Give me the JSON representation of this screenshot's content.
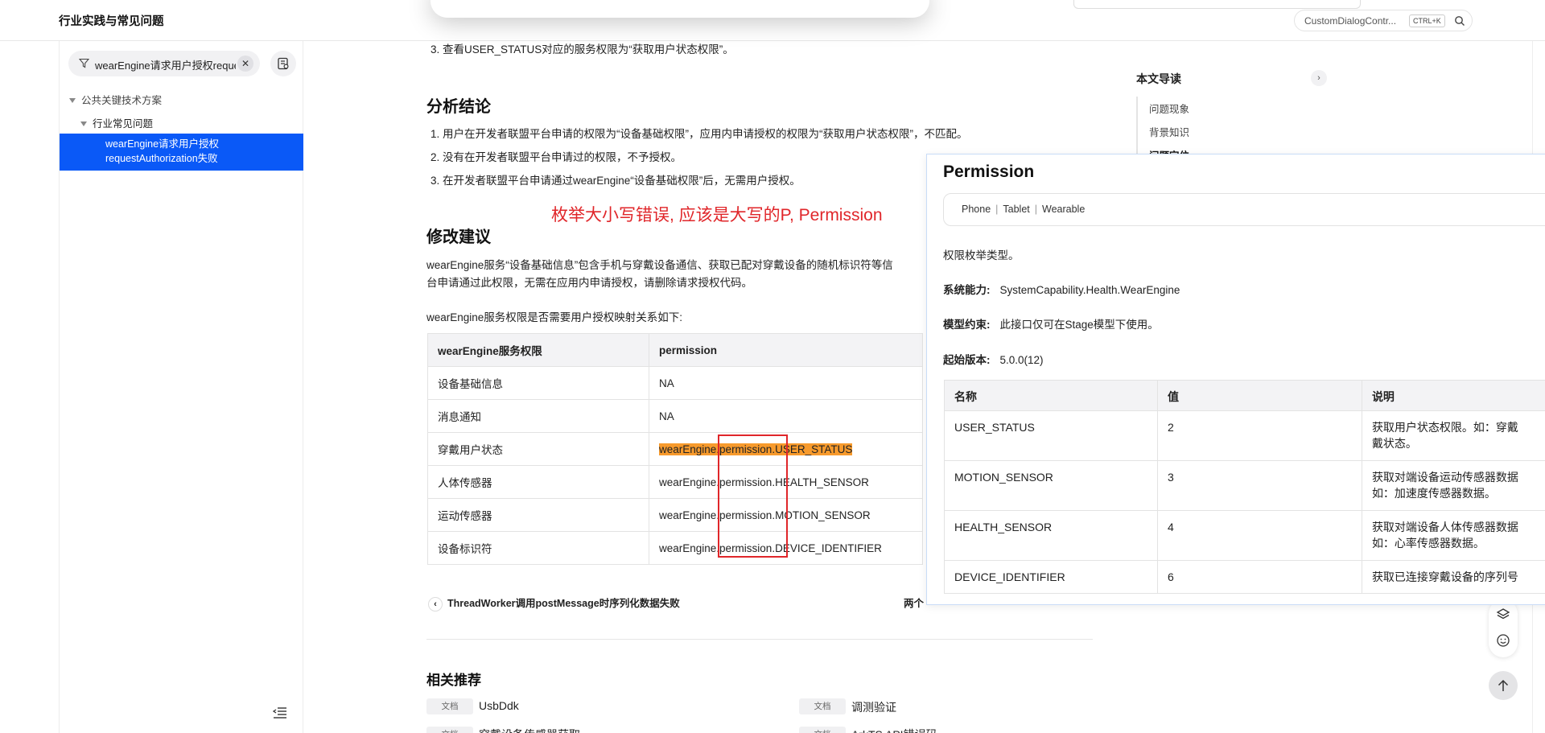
{
  "header": {
    "title": "行业实践与常见问题",
    "search_text": "CustomDialogContr...",
    "search_kbd": "CTRL+K"
  },
  "sidebar": {
    "filter_text": "wearEngine请求用户授权requestAuthorization失败",
    "items": [
      {
        "label": "公共关键技术方案"
      },
      {
        "label": "行业常见问题"
      }
    ],
    "active_line1": "wearEngine请求用户授权",
    "active_line2": "requestAuthorization失败"
  },
  "doc": {
    "step3": "3. 查看USER_STATUS对应的服务权限为“获取用户状态权限”。",
    "h_conclusion": "分析结论",
    "c1": "1. 用户在开发者联盟平台申请的权限为“设备基础权限”，应用内申请授权的权限为“获取用户状态权限”，不匹配。",
    "c2": "2. 没有在开发者联盟平台申请过的权限，不予授权。",
    "c3": "3. 在开发者联盟平台申请通过wearEngine“设备基础权限”后，无需用户授权。",
    "red_note": "枚举大小写错误, 应该是大写的P, Permission",
    "h_suggest": "修改建议",
    "s1": "wearEngine服务“设备基础信息”包含手机与穿戴设备通信、获取已配对穿戴设备的随机标识符等信",
    "s2": "台申请通过此权限，无需在应用内申请授权，请删除请求授权代码。",
    "s3": "wearEngine服务权限是否需要用户授权映射关系如下:",
    "table": {
      "headers": [
        "wearEngine服务权限",
        "permission"
      ],
      "rows": [
        [
          "设备基础信息",
          "NA"
        ],
        [
          "消息通知",
          "NA"
        ],
        [
          "穿戴用户状态",
          "wearEngine.permission.USER_STATUS"
        ],
        [
          "人体传感器",
          "wearEngine.permission.HEALTH_SENSOR"
        ],
        [
          "运动传感器",
          "wearEngine.permission.MOTION_SENSOR"
        ],
        [
          "设备标识符",
          "wearEngine.permission.DEVICE_IDENTIFIER"
        ]
      ]
    },
    "prev_link": "ThreadWorker调用postMessage时序列化数据失败",
    "next_link": "两个",
    "h_related": "相关推荐",
    "related": [
      {
        "tag": "文档",
        "title": "UsbDdk"
      },
      {
        "tag": "文档",
        "title": "调测验证"
      },
      {
        "tag": "文档",
        "title": "穿戴设备传感器获取"
      },
      {
        "tag": "文档",
        "title": "ArkTS API错误码"
      }
    ]
  },
  "toc": {
    "title": "本文导读",
    "items": [
      "问题现象",
      "背景知识",
      "问题定位"
    ]
  },
  "popup": {
    "title": "Permission",
    "devices": [
      "Phone",
      "Tablet",
      "Wearable"
    ],
    "desc": "权限枚举类型。",
    "syscap_label": "系统能力:",
    "syscap_value": "SystemCapability.Health.WearEngine",
    "model_label": "模型约束:",
    "model_value": "此接口仅可在Stage模型下使用。",
    "since_label": "起始版本:",
    "since_value": "5.0.0(12)",
    "table": {
      "headers": [
        "名称",
        "值",
        "说明"
      ],
      "rows": [
        {
          "name": "USER_STATUS",
          "value": "2",
          "desc1": "获取用户状态权限。如：穿戴",
          "desc2": "戴状态。"
        },
        {
          "name": "MOTION_SENSOR",
          "value": "3",
          "desc1": "获取对端设备运动传感器数据",
          "desc2": "如：加速度传感器数据。"
        },
        {
          "name": "HEALTH_SENSOR",
          "value": "4",
          "desc1": "获取对端设备人体传感器数据",
          "desc2": "如：心率传感器数据。"
        },
        {
          "name": "DEVICE_IDENTIFIER",
          "value": "6",
          "desc1": "获取已连接穿戴设备的序列号",
          "desc2": ""
        }
      ]
    }
  },
  "colors": {
    "accent": "#0a59f7",
    "highlight": "#f79a2c",
    "annotation_red": "#e0262a"
  }
}
